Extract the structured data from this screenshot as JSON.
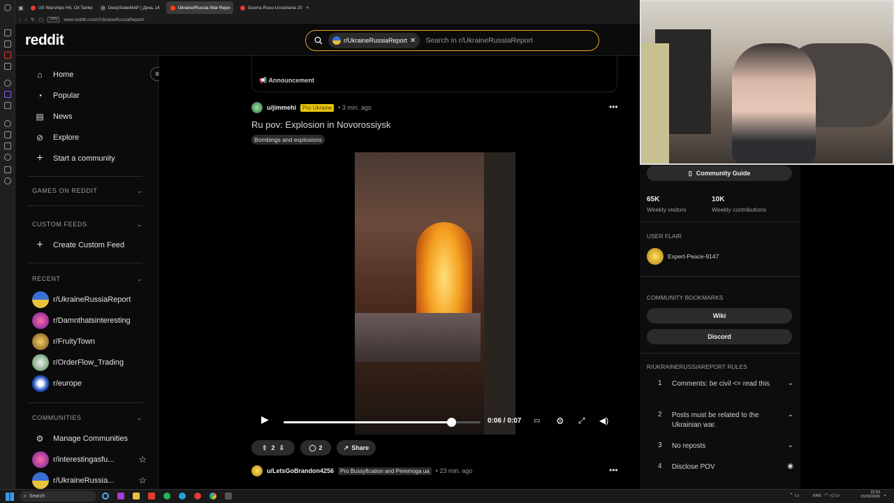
{
  "browser": {
    "tabs": [
      {
        "label": "US Warships Hit, Oil Tanke",
        "color": "#e53935"
      },
      {
        "label": "DeepStateMAP | День 14",
        "color": "#444444"
      },
      {
        "label": "Ukraine/Russia War Repo",
        "color": "#ff4500"
      },
      {
        "label": "Guerra Ruso-Ucraniana 20",
        "color": "#e53935"
      }
    ],
    "new_tab": "+",
    "url": "www.reddit.com/r/UkraineRussiaReport/",
    "vpn": "VPN"
  },
  "header": {
    "logo": "reddit",
    "search_chip": "r/UkraineRussiaReport",
    "search_placeholder": "Search in r/UkraineRussiaReport"
  },
  "sidebar": {
    "nav": [
      {
        "label": "Home",
        "icon": "home-icon"
      },
      {
        "label": "Popular",
        "icon": "popular-icon"
      },
      {
        "label": "News",
        "icon": "news-icon"
      },
      {
        "label": "Explore",
        "icon": "explore-icon"
      },
      {
        "label": "Start a community",
        "icon": "plus-icon"
      }
    ],
    "games_header": "GAMES ON REDDIT",
    "feeds_header": "CUSTOM FEEDS",
    "create_feed": "Create Custom Feed",
    "recent_header": "RECENT",
    "recent": [
      {
        "label": "r/UkraineRussiaReport",
        "color": "#3b6fd6"
      },
      {
        "label": "r/Damnthatsinteresting",
        "color": "#c02bd6"
      },
      {
        "label": "r/FruityTown",
        "color": "#e5b84a"
      },
      {
        "label": "r/OrderFlow_Trading",
        "color": "#3a8f3a"
      },
      {
        "label": "r/europe",
        "color": "#1f4fbf"
      }
    ],
    "communities_header": "COMMUNITIES",
    "manage": "Manage Communities",
    "communities": [
      {
        "label": "r/interestingasfu...",
        "color": "#a93fd6"
      },
      {
        "label": "r/UkraineRussia...",
        "color": "#3b6fd6"
      }
    ]
  },
  "feed": {
    "announcement": "Announcement",
    "post1": {
      "user": "u/jimmehi",
      "flair": "Pro Ukraine",
      "time": "• 3 min. ago",
      "title": "Ru pov: Explosion in Novorossiysk",
      "tag": "Bombings and explosions",
      "video_time": "0:06 / 0:07",
      "progress": 0.85,
      "votes": "2",
      "comments": "2",
      "share": "Share"
    },
    "post2": {
      "user": "u/LetsGoBrandon4256",
      "flair": "Pro Bussyfication and Peremoga ua",
      "time": "• 23 min. ago"
    }
  },
  "right": {
    "guide": "Community Guide",
    "stats": [
      {
        "value": "65K",
        "label": "Weekly visitors"
      },
      {
        "value": "10K",
        "label": "Weekly contributions"
      }
    ],
    "user_flair_header": "USER FLAIR",
    "user_flair": "Expert-Peace-9147",
    "bookmarks_header": "COMMUNITY BOOKMARKS",
    "bookmarks": [
      "Wiki",
      "Discord"
    ],
    "rules_header": "R/UKRAINERUSSIAREPORT RULES",
    "rules": [
      {
        "n": "1",
        "text": "Comments: be civil <= read this"
      },
      {
        "n": "2",
        "text": "Posts must be related to the Ukrainian war."
      },
      {
        "n": "3",
        "text": "No reposts"
      },
      {
        "n": "4",
        "text": "Disclose POV"
      }
    ]
  },
  "taskbar": {
    "search": "Search",
    "lang": "ENG",
    "time": "22:53",
    "date": "01/03/2026"
  }
}
